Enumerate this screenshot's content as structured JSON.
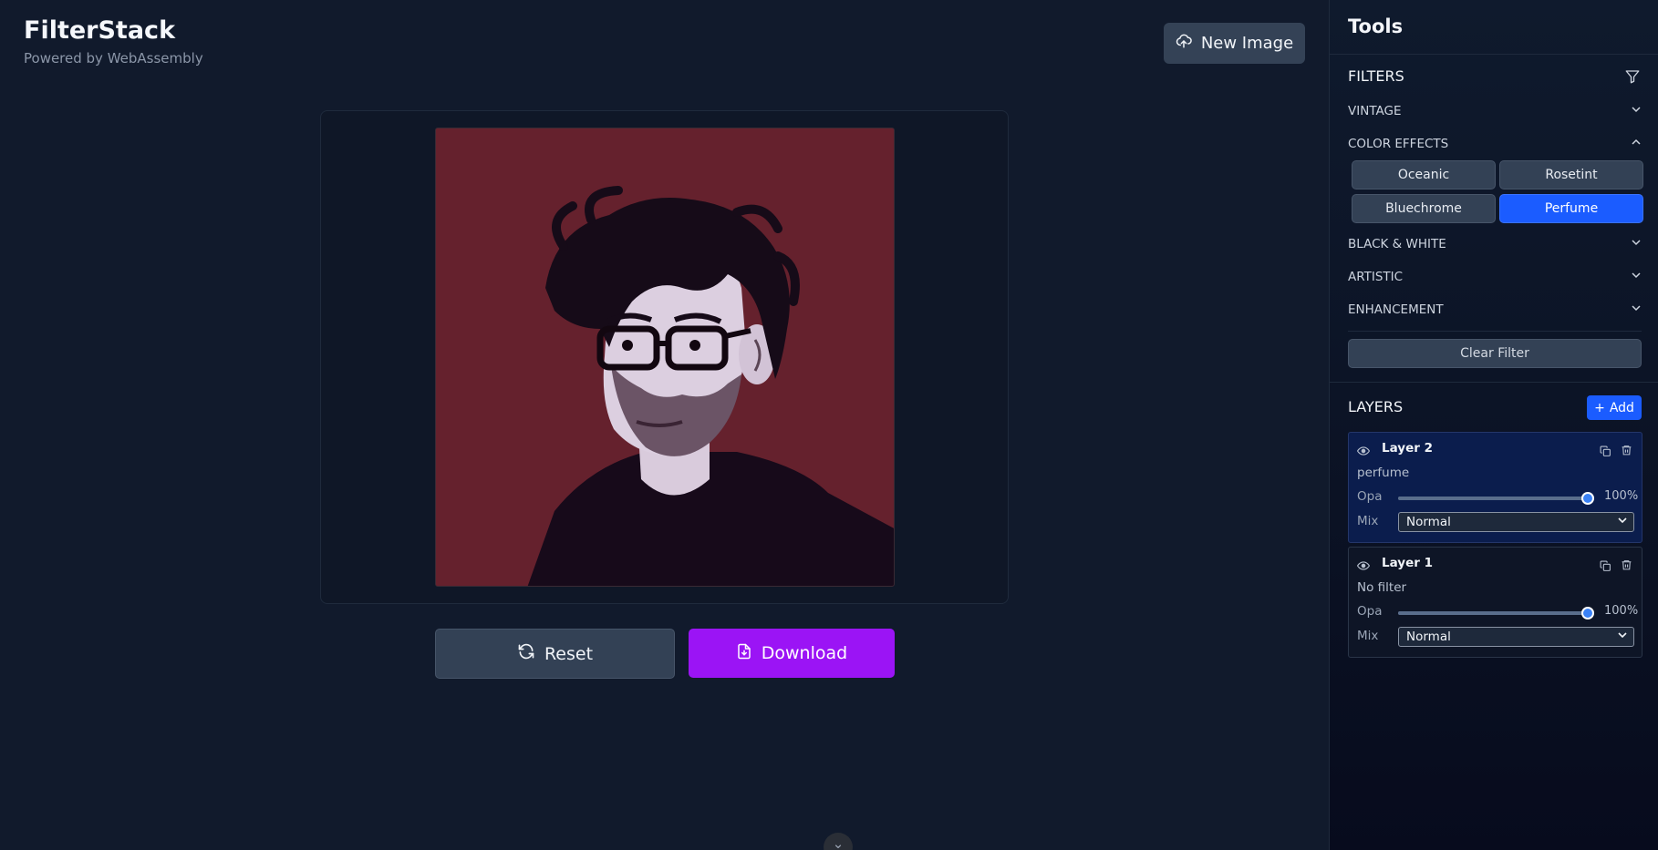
{
  "app": {
    "title": "FilterStack",
    "subtitle": "Powered by WebAssembly",
    "new_image_label": "New Image"
  },
  "actions": {
    "reset_label": "Reset",
    "download_label": "Download"
  },
  "colors": {
    "accent_blue": "#1b5cff",
    "download_purple": "#9b14f5",
    "image_background": "#65212d"
  },
  "sidebar": {
    "title": "Tools",
    "filters": {
      "heading": "FILTERS",
      "categories": [
        {
          "label": "VINTAGE",
          "expanded": false
        },
        {
          "label": "COLOR EFFECTS",
          "expanded": true
        },
        {
          "label": "BLACK & WHITE",
          "expanded": false
        },
        {
          "label": "ARTISTIC",
          "expanded": false
        },
        {
          "label": "ENHANCEMENT",
          "expanded": false
        }
      ],
      "color_effects": [
        {
          "label": "Oceanic",
          "active": false
        },
        {
          "label": "Rosetint",
          "active": false
        },
        {
          "label": "Bluechrome",
          "active": false
        },
        {
          "label": "Perfume",
          "active": true
        }
      ],
      "clear_label": "Clear Filter"
    },
    "layers": {
      "heading": "LAYERS",
      "add_label": "Add",
      "items": [
        {
          "name": "Layer 2",
          "filter": "perfume",
          "opacity_label": "Opa",
          "opacity": "100%",
          "opacity_value": 100,
          "mix_label": "Mix",
          "mix": "Normal",
          "selected": true
        },
        {
          "name": "Layer 1",
          "filter": "No filter",
          "opacity_label": "Opa",
          "opacity": "100%",
          "opacity_value": 100,
          "mix_label": "Mix",
          "mix": "Normal",
          "selected": false
        }
      ]
    }
  }
}
